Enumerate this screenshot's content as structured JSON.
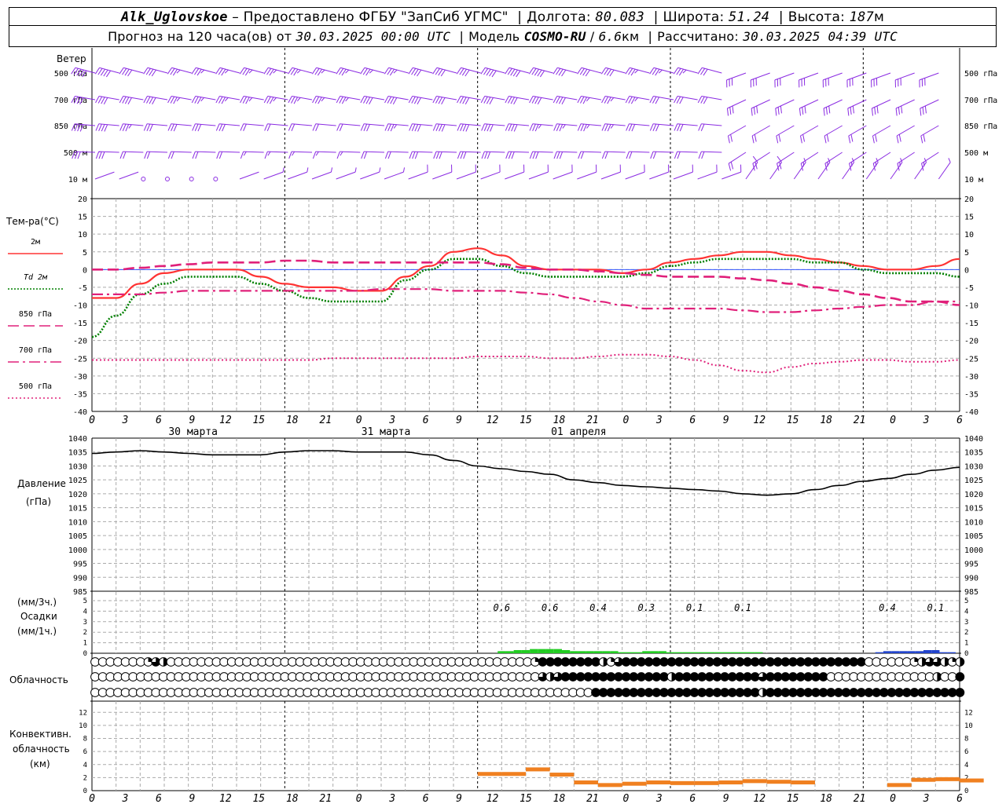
{
  "header": {
    "station": "Alk_Uglovskoe",
    "provider": "Предоставлено ФГБУ \"ЗапСиб УГМС\"",
    "lon_label": "Долгота:",
    "lon": "80.083",
    "lat_label": "Широта:",
    "lat": "51.24",
    "alt_label": "Высота:",
    "alt": "187",
    "alt_unit": "м",
    "forecast_label": "Прогноз на 120 часа(ов) от",
    "forecast_start": "30.03.2025 00:00 UTC",
    "model_label": "Модель",
    "model": "COSMO-RU",
    "resolution": "6.6",
    "res_unit": "км",
    "computed_label": "Рассчитано:",
    "computed": "30.03.2025 04:39 UTC"
  },
  "wind_panel": {
    "title": "Ветер",
    "levels": [
      "500 гПа",
      "700 гПа",
      "850 гПа",
      "500 м",
      "10 м"
    ]
  },
  "temp_panel": {
    "title": "Тем-ра(°C)",
    "legend": [
      {
        "label": "2м",
        "color": "#ff3333",
        "style": "solid"
      },
      {
        "label": "Td 2м",
        "color": "#008000",
        "style": "dotted"
      },
      {
        "label": "850 гПа",
        "color": "#e0207a",
        "style": "dashed"
      },
      {
        "label": "700 гПа",
        "color": "#e0207a",
        "style": "dashdot"
      },
      {
        "label": "500 гПа",
        "color": "#e0207a",
        "style": "dotted"
      }
    ]
  },
  "hour_ticks": [
    "0",
    "3",
    "6",
    "9",
    "12",
    "15",
    "18",
    "21",
    "0",
    "3",
    "6",
    "9",
    "12",
    "15",
    "18",
    "21",
    "0",
    "3",
    "6",
    "9",
    "12",
    "15",
    "18",
    "21",
    "0",
    "3",
    "6"
  ],
  "day_labels": [
    "30 марта",
    "31 марта",
    "01 апреля"
  ],
  "pressure_panel": {
    "title": "Давление",
    "unit": "(гПа)"
  },
  "precip_panel": {
    "unit1": "(мм/3ч.)",
    "title": "Осадки",
    "unit2": "(мм/1ч.)",
    "labels": [
      {
        "hour": 51,
        "text": "0.6"
      },
      {
        "hour": 57,
        "text": "0.6"
      },
      {
        "hour": 63,
        "text": "0.4"
      },
      {
        "hour": 69,
        "text": "0.3"
      },
      {
        "hour": 75,
        "text": "0.1"
      },
      {
        "hour": 81,
        "text": "0.1"
      },
      {
        "hour": 99,
        "text": "0.4"
      },
      {
        "hour": 105,
        "text": "0.1"
      }
    ]
  },
  "cloud_panel": {
    "title": "Облачность"
  },
  "conv_panel": {
    "title1": "Конвективн.",
    "title2": "облачность",
    "unit": "(км)"
  },
  "colors": {
    "wind": "#8a2be2",
    "t2m": "#ff3333",
    "td": "#008000",
    "upper": "#e0207a",
    "precip_green": "#22cc22",
    "precip_blue": "#2244cc",
    "conv": "#f08020"
  },
  "chart_data": [
    {
      "type": "line",
      "name": "temperature",
      "x": [
        0,
        3,
        6,
        9,
        12,
        15,
        18,
        21,
        24,
        27,
        30,
        33,
        36,
        39,
        42,
        45,
        48,
        51,
        54,
        57,
        60,
        63,
        66,
        69,
        72,
        75,
        78,
        81,
        84,
        87,
        90,
        93,
        96,
        99,
        102,
        105,
        108
      ],
      "series": [
        {
          "name": "2м",
          "values": [
            -8,
            -8,
            -4,
            -1,
            0,
            0,
            0,
            -2,
            -4,
            -5,
            -5,
            -6,
            -6,
            -2,
            1,
            5,
            6,
            4,
            1,
            0,
            0,
            0,
            -1,
            0,
            2,
            3,
            4,
            5,
            5,
            4,
            3,
            2,
            1,
            0,
            0,
            1,
            3
          ]
        },
        {
          "name": "Td 2м",
          "values": [
            -19,
            -13,
            -7,
            -4,
            -2,
            -2,
            -2,
            -4,
            -6,
            -8,
            -9,
            -9,
            -9,
            -3,
            0,
            3,
            3,
            1,
            -1,
            -2,
            -2,
            -2,
            -2,
            -1,
            1,
            2,
            3,
            3,
            3,
            3,
            2,
            2,
            0,
            -1,
            -1,
            -1,
            -2
          ]
        },
        {
          "name": "850 гПа",
          "values": [
            0,
            0,
            0.5,
            1,
            1.5,
            2,
            2,
            2,
            2.5,
            2.5,
            2,
            2,
            2,
            2,
            2,
            2,
            2,
            1.5,
            0.5,
            0,
            0,
            -0.5,
            -1,
            -1.5,
            -2,
            -2,
            -2,
            -2.5,
            -3,
            -4,
            -5,
            -6,
            -7,
            -8,
            -9,
            -9,
            -10
          ]
        },
        {
          "name": "700 гПа",
          "values": [
            -7,
            -7,
            -7,
            -6.5,
            -6,
            -6,
            -6,
            -6,
            -6,
            -6,
            -6,
            -6,
            -5.5,
            -5.5,
            -5.5,
            -6,
            -6,
            -6,
            -6.5,
            -7,
            -8,
            -9,
            -10,
            -11,
            -11,
            -11,
            -11,
            -11.5,
            -12,
            -12,
            -11.5,
            -11,
            -10.5,
            -10,
            -10,
            -9,
            -9
          ]
        },
        {
          "name": "500 гПа",
          "values": [
            -25.5,
            -25.5,
            -25.5,
            -25.5,
            -25.5,
            -25.5,
            -25.5,
            -25.5,
            -25.5,
            -25.5,
            -25,
            -25,
            -25,
            -25,
            -25,
            -25,
            -24.5,
            -24.5,
            -24.5,
            -25,
            -25,
            -24.5,
            -24,
            -24,
            -24.5,
            -25.5,
            -27,
            -28.5,
            -29,
            -27.5,
            -26.5,
            -26,
            -25.5,
            -25.5,
            -26,
            -26,
            -25.5
          ]
        }
      ],
      "ylim": [
        -40,
        20
      ],
      "yticks": [
        20,
        15,
        10,
        5,
        0,
        -5,
        -10,
        -15,
        -20,
        -25,
        -30,
        -35,
        -40
      ],
      "grid": true
    },
    {
      "type": "line",
      "name": "pressure",
      "x": [
        0,
        3,
        6,
        9,
        12,
        15,
        18,
        21,
        24,
        27,
        30,
        33,
        36,
        39,
        42,
        45,
        48,
        51,
        54,
        57,
        60,
        63,
        66,
        69,
        72,
        75,
        78,
        81,
        84,
        87,
        90,
        93,
        96,
        99,
        102,
        105,
        108
      ],
      "values": [
        1034.5,
        1035,
        1035.5,
        1035,
        1034.5,
        1034,
        1034,
        1034,
        1035,
        1035.5,
        1035.5,
        1035,
        1035,
        1035,
        1034,
        1032,
        1030,
        1029,
        1028,
        1027,
        1025,
        1024,
        1023,
        1022.5,
        1022,
        1021.5,
        1021,
        1020,
        1019.5,
        1020,
        1021.5,
        1023,
        1024.5,
        1025.5,
        1027,
        1028.5,
        1029.5
      ],
      "ylim": [
        985,
        1040
      ],
      "yticks": [
        1040,
        1035,
        1030,
        1025,
        1020,
        1015,
        1010,
        1005,
        1000,
        995,
        990,
        985
      ],
      "grid": true
    },
    {
      "type": "bar",
      "name": "precipitation",
      "x": [
        51,
        52,
        53,
        54,
        55,
        56,
        57,
        58,
        59,
        60,
        61,
        62,
        63,
        64,
        65,
        66,
        67,
        68,
        69,
        70,
        71,
        72,
        73,
        74,
        75,
        76,
        77,
        78,
        79,
        80,
        81,
        82,
        83,
        98,
        99,
        100,
        101,
        102,
        103,
        104,
        105,
        106,
        107
      ],
      "values": [
        0.2,
        0.2,
        0.3,
        0.3,
        0.4,
        0.4,
        0.4,
        0.4,
        0.3,
        0.2,
        0.2,
        0.2,
        0.2,
        0.2,
        0.2,
        0.1,
        0.1,
        0.1,
        0.2,
        0.2,
        0.2,
        0.1,
        0.1,
        0.1,
        0.1,
        0.1,
        0.1,
        0.1,
        0.1,
        0.1,
        0.1,
        0.1,
        0.1,
        0.1,
        0.2,
        0.2,
        0.2,
        0.2,
        0.2,
        0.3,
        0.3,
        0.1,
        0.1
      ],
      "ylim": [
        0,
        5
      ],
      "yticks": [
        5,
        4,
        3,
        2,
        1,
        0
      ]
    },
    {
      "type": "bar",
      "name": "convective_cloud",
      "x": [
        48,
        51,
        54,
        57,
        60,
        63,
        66,
        69,
        72,
        75,
        78,
        81,
        84,
        87,
        90,
        93,
        96,
        99,
        102,
        105,
        108
      ],
      "values": [
        2.5,
        2.5,
        3.2,
        2.4,
        1.2,
        0.8,
        1.0,
        1.2,
        1.1,
        1.1,
        1.2,
        1.4,
        1.3,
        1.2,
        0,
        0,
        0,
        0.8,
        1.6,
        1.7,
        1.5
      ],
      "ylim": [
        0,
        13
      ],
      "yticks": [
        12,
        10,
        8,
        6,
        4,
        2,
        0
      ]
    },
    {
      "type": "table",
      "name": "cloudiness",
      "rows_levels": [
        "upper",
        "middle",
        "lower"
      ],
      "upper": [
        0,
        0,
        0,
        0,
        0,
        0,
        0,
        1,
        3,
        2,
        0,
        0,
        0,
        0,
        0,
        0,
        0,
        0,
        0,
        0,
        0,
        0,
        0,
        0,
        0,
        0,
        0,
        0,
        0,
        0,
        0,
        0,
        0,
        0,
        0,
        0,
        0,
        0,
        0,
        0,
        0,
        0,
        0,
        0,
        0,
        0,
        0,
        0,
        0,
        0,
        0,
        0,
        0,
        0,
        0,
        0,
        0,
        0,
        1,
        4,
        4,
        4,
        4,
        4,
        4,
        4,
        4,
        2,
        1,
        3,
        4,
        4,
        4,
        4,
        4,
        4,
        4,
        4,
        4,
        4,
        4,
        4,
        4,
        4,
        4,
        4,
        4,
        4,
        4,
        4,
        4,
        4,
        4,
        4,
        4,
        4,
        4,
        4,
        4,
        4,
        4,
        4,
        0,
        0,
        0,
        0,
        0,
        0,
        1,
        2,
        3,
        3,
        2,
        1,
        2
      ],
      "middle": [
        0,
        0,
        0,
        0,
        0,
        0,
        0,
        0,
        0,
        0,
        0,
        0,
        0,
        0,
        0,
        0,
        0,
        0,
        0,
        0,
        0,
        0,
        0,
        0,
        0,
        0,
        0,
        0,
        0,
        0,
        0,
        0,
        0,
        0,
        0,
        0,
        0,
        0,
        0,
        0,
        0,
        0,
        0,
        0,
        0,
        0,
        0,
        0,
        0,
        0,
        0,
        0,
        0,
        0,
        0,
        0,
        0,
        0,
        0,
        3,
        2,
        3,
        4,
        4,
        4,
        4,
        4,
        4,
        4,
        4,
        4,
        4,
        4,
        4,
        4,
        4,
        2,
        4,
        4,
        4,
        4,
        4,
        4,
        4,
        4,
        4,
        4,
        4,
        3,
        4,
        4,
        4,
        4,
        4,
        4,
        4,
        4,
        0,
        0,
        0,
        0,
        0,
        0,
        0,
        0,
        0,
        0,
        0,
        0,
        0,
        0,
        2,
        0,
        0,
        4
      ],
      "lower": [
        0,
        0,
        0,
        0,
        0,
        0,
        0,
        0,
        0,
        0,
        0,
        0,
        0,
        0,
        0,
        0,
        0,
        0,
        0,
        0,
        0,
        0,
        0,
        0,
        0,
        0,
        0,
        0,
        0,
        0,
        0,
        0,
        0,
        0,
        0,
        0,
        0,
        0,
        0,
        0,
        0,
        0,
        0,
        0,
        0,
        0,
        0,
        0,
        0,
        0,
        0,
        0,
        0,
        0,
        0,
        0,
        0,
        0,
        0,
        0,
        0,
        0,
        0,
        0,
        0,
        0,
        4,
        4,
        4,
        4,
        4,
        4,
        4,
        4,
        4,
        4,
        4,
        4,
        4,
        4,
        4,
        4,
        4,
        4,
        4,
        4,
        4,
        4,
        2,
        4,
        4,
        4,
        4,
        4,
        4,
        4,
        4,
        4,
        4,
        4,
        4,
        4,
        4,
        4,
        4,
        4,
        4,
        4,
        4,
        4,
        4,
        4,
        4,
        4,
        4
      ]
    },
    {
      "type": "scatter",
      "name": "wind_barbs",
      "levels": [
        "500 гПа",
        "700 гПа",
        "850 гПа",
        "500 м",
        "10 м"
      ],
      "x": [
        0,
        3,
        6,
        9,
        12,
        15,
        18,
        21,
        24,
        27,
        30,
        33,
        36,
        39,
        42,
        45,
        48,
        51,
        54,
        57,
        60,
        63,
        66,
        69,
        72,
        75,
        78,
        81,
        84,
        87,
        90,
        93,
        96,
        99,
        102,
        105,
        108
      ],
      "speed_ms": [
        [
          25,
          25,
          22,
          20,
          18,
          18,
          18,
          18,
          18,
          18,
          18,
          18,
          18,
          18,
          20,
          22,
          22,
          25,
          25,
          25,
          22,
          20,
          20,
          18,
          18,
          18,
          15,
          15,
          15,
          15,
          15,
          15,
          15,
          15,
          15,
          15,
          15
        ],
        [
          22,
          22,
          20,
          20,
          18,
          18,
          18,
          18,
          18,
          18,
          18,
          18,
          20,
          22,
          22,
          22,
          22,
          22,
          22,
          20,
          20,
          18,
          18,
          18,
          15,
          15,
          15,
          15,
          15,
          15,
          15,
          15,
          15,
          15,
          15,
          15,
          15
        ],
        [
          20,
          20,
          18,
          15,
          15,
          15,
          15,
          12,
          12,
          12,
          12,
          12,
          15,
          18,
          20,
          20,
          20,
          20,
          20,
          18,
          18,
          18,
          18,
          15,
          15,
          15,
          12,
          12,
          12,
          12,
          10,
          10,
          10,
          10,
          10,
          10,
          10
        ],
        [
          15,
          15,
          12,
          10,
          10,
          10,
          10,
          8,
          8,
          8,
          8,
          8,
          10,
          12,
          15,
          15,
          15,
          15,
          15,
          15,
          15,
          12,
          12,
          12,
          12,
          12,
          12,
          10,
          10,
          10,
          8,
          8,
          8,
          8,
          8,
          8,
          8
        ],
        [
          2,
          1,
          0,
          0,
          0,
          0,
          2,
          3,
          3,
          3,
          3,
          3,
          4,
          5,
          5,
          5,
          5,
          5,
          5,
          5,
          5,
          5,
          5,
          5,
          5,
          5,
          5,
          5,
          5,
          4,
          4,
          4,
          4,
          4,
          4,
          4,
          4
        ]
      ]
    }
  ]
}
